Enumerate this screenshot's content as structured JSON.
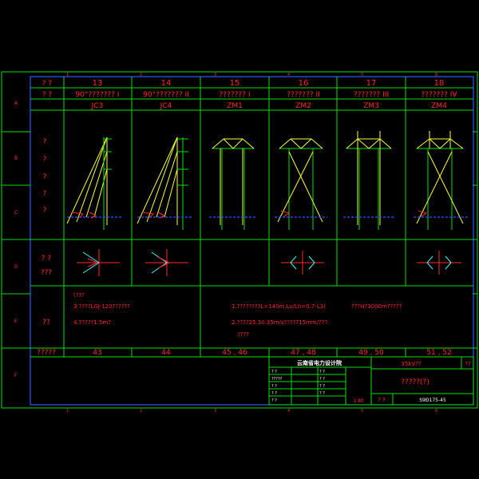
{
  "border_letters": [
    "A",
    "B",
    "C",
    "D",
    "E",
    "F"
  ],
  "border_numbers": [
    "1",
    "2",
    "3",
    "4",
    "5",
    "6"
  ],
  "row_labels": {
    "number": "? ?",
    "type": "? ?",
    "diagram": [
      "?",
      "?",
      "?",
      "?",
      "?"
    ],
    "plan": [
      "? ?",
      "???"
    ],
    "notes": "??",
    "pages": "?????"
  },
  "columns": [
    {
      "num": "13",
      "type": "90°??????? I",
      "code": "JC3",
      "pages": "43"
    },
    {
      "num": "14",
      "type": "90°??????? II",
      "code": "JC4",
      "pages": "44"
    },
    {
      "num": "15",
      "type": "??????? I",
      "code": "ZM1",
      "pages": "45 , 46"
    },
    {
      "num": "16",
      "type": "??????? II",
      "code": "ZM2",
      "pages": "47 , 48"
    },
    {
      "num": "17",
      "type": "??????? III",
      "code": "ZM3",
      "pages": "49 , 50"
    },
    {
      "num": "18",
      "type": "??????? IV",
      "code": "ZM4",
      "pages": "51 , 52"
    }
  ],
  "notes_left": [
    "(???",
    "3.????LGJ-120??????",
    "4.?????1.5m?"
  ],
  "notes_right": [
    "1.????????L=140m,Lv/Lh=0.7-L3)",
    "???H?3000m?????",
    "2.????25.30.35m/s?????15mm/???",
    "(???"
  ],
  "title_block": {
    "company": "云南省电力设计院",
    "voltage": "35kV??",
    "drawing_title": "?????(?)",
    "stamp": "??",
    "row_qs": [
      "? ?",
      "?????",
      "? ?",
      "? ?",
      "? ?"
    ],
    "scale": "1:80",
    "label": "? ?",
    "drawing_no": "S9Ð175-45"
  },
  "colors": {
    "frame": "#00e000",
    "text": "#ff2a2a",
    "tower": "#ffff33",
    "member": "#33ffff",
    "ground": "#3355ff"
  }
}
